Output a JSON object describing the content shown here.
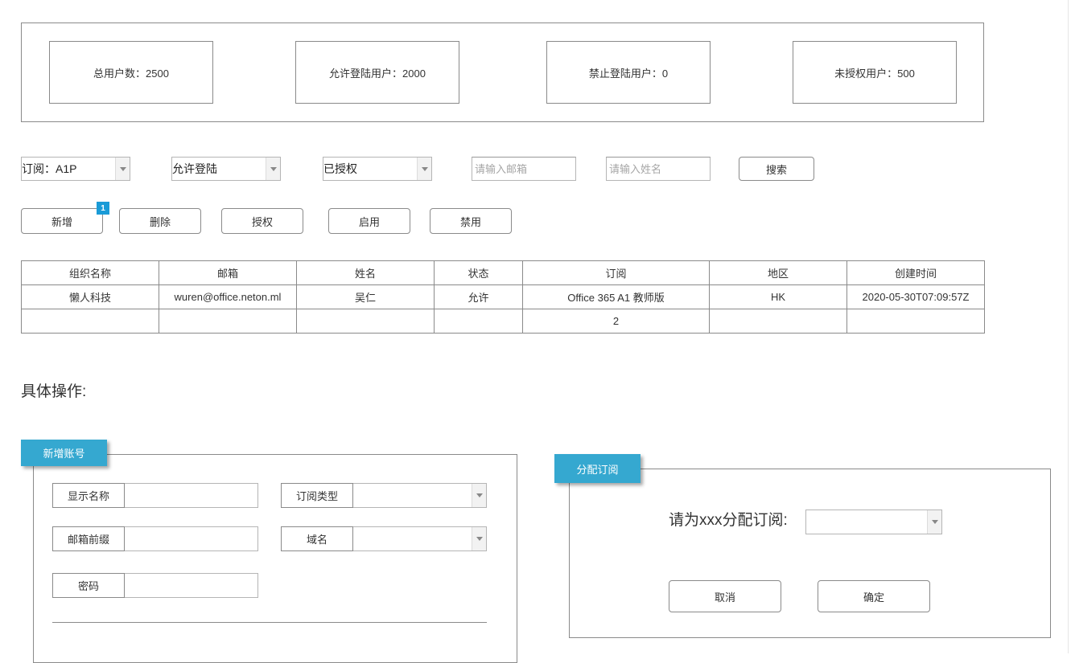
{
  "stats": [
    {
      "label": "总用户数：2500"
    },
    {
      "label": "允许登陆用户：2000"
    },
    {
      "label": "禁止登陆用户：0"
    },
    {
      "label": "未授权用户：500"
    }
  ],
  "filters": {
    "subscription": "订阅：A1P",
    "login_status": "允许登陆",
    "auth_status": "已授权",
    "email_placeholder": "请输入邮箱",
    "name_placeholder": "请输入姓名",
    "search_label": "搜索"
  },
  "actions": {
    "add": "新增",
    "add_badge": "1",
    "delete": "删除",
    "authorize": "授权",
    "enable": "启用",
    "disable": "禁用"
  },
  "table": {
    "columns": [
      "组织名称",
      "邮箱",
      "姓名",
      "状态",
      "订阅",
      "地区",
      "创建时间"
    ],
    "rows": [
      [
        "懒人科技",
        "wuren@office.neton.ml",
        "吴仁",
        "允许",
        "Office 365 A1 教师版",
        "HK",
        "2020-05-30T07:09:57Z"
      ],
      [
        "",
        "",
        "",
        "",
        "2",
        "",
        ""
      ]
    ]
  },
  "section_title": "具体操作:",
  "new_account": {
    "tag": "新增账号",
    "display_name_label": "显示名称",
    "subscription_type_label": "订阅类型",
    "email_prefix_label": "邮箱前缀",
    "domain_label": "域名",
    "password_label": "密码"
  },
  "assign": {
    "tag": "分配订阅",
    "prompt": "请为xxx分配订阅:",
    "cancel": "取消",
    "confirm": "确定"
  },
  "colors": {
    "tag_blue": "#35a8d0",
    "badge_blue": "#1a9bd7",
    "border_gray": "#8a8a8a"
  }
}
